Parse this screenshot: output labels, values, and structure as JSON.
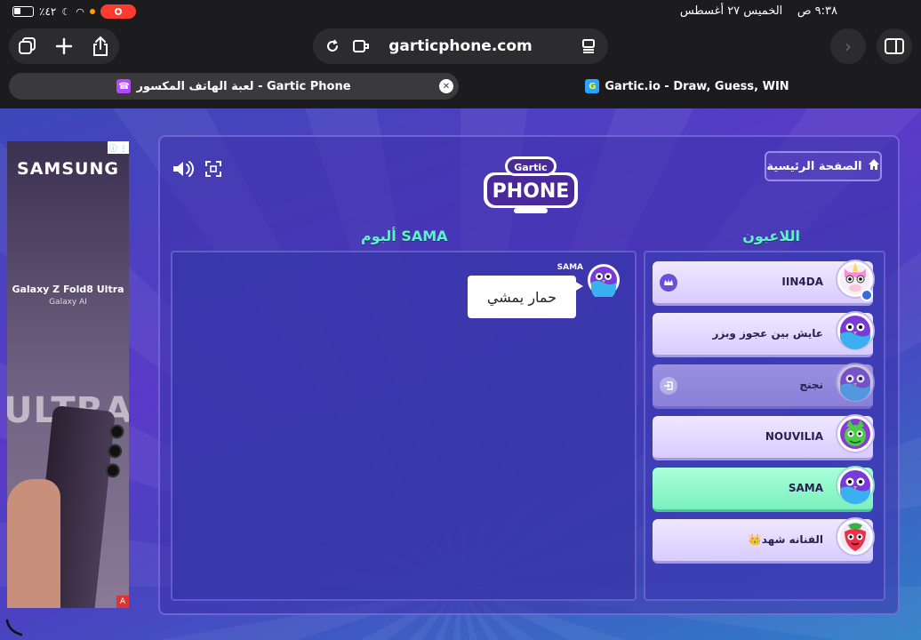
{
  "status_bar": {
    "battery": "٪٤٢",
    "datetime": "الخميس ٢٧ أغسطس",
    "time": "٩:٣٨ ص"
  },
  "browser": {
    "url": "garticphone.com",
    "tabs": [
      {
        "title": "لعبة الهاتف المكسور - Gartic Phone",
        "active": true
      },
      {
        "title": "Gartic.io - Draw, Guess, WIN",
        "active": false
      }
    ]
  },
  "ad": {
    "brand": "SAMSUNG",
    "product": "Galaxy Z Fold8 Ultra",
    "sub": "Galaxy AI",
    "big": "ULTRA",
    "corner": "A"
  },
  "game": {
    "logo_top": "Gartic",
    "logo_main": "PHONE",
    "home_label": "الصفحة الرئيسية",
    "album_title": "ألبوم SAMA",
    "players_title": "اللاعبون",
    "album_entry": {
      "name": "SAMA",
      "text": "حمار يمشي"
    },
    "players": [
      {
        "name": "IIN4DA",
        "state": "host"
      },
      {
        "name": "عايش بين عجوز وبزر",
        "state": "normal"
      },
      {
        "name": "نجنج",
        "state": "left"
      },
      {
        "name": "NOUVILIA",
        "state": "normal"
      },
      {
        "name": "SAMA",
        "state": "me"
      },
      {
        "name": "الفنانه شهد👑",
        "state": "normal"
      }
    ]
  },
  "colors": {
    "accent": "#5ef0d0",
    "page_bg_top": "#5a3ac8",
    "page_bg_bottom": "#2f7fc8",
    "me_row": "#7af0bf"
  }
}
